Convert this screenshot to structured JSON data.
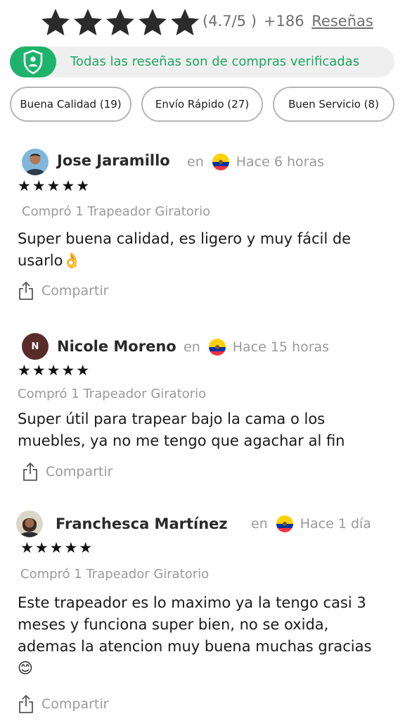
{
  "summary": {
    "star_count": 5,
    "rating": "(4.7/5 )",
    "count": "+186",
    "reviews_link": "Reseñas"
  },
  "verified_banner": {
    "text": "Todas las reseñas son de compras verificadas",
    "icon": "verified-shield-icon",
    "color": "#1db36a"
  },
  "filters": [
    {
      "label": "Buena Calidad (19)"
    },
    {
      "label": "Envío Rápido (27)"
    },
    {
      "label": "Buen Servicio (8)"
    }
  ],
  "reviews": [
    {
      "name": "Jose Jaramillo",
      "avatar": "photo",
      "en": "en",
      "flag": "ecuador-flag-icon",
      "time": "Hace 6 horas",
      "stars": "★★★★★",
      "bought": "Compró 1 Trapeador Giratorio",
      "text": "Super buena calidad, es ligero y muy fácil de usarlo👌",
      "share": "Compartir"
    },
    {
      "name": "Nicole Moreno",
      "avatar": "N",
      "en": "en",
      "flag": "ecuador-flag-icon",
      "time": "Hace 15 horas",
      "stars": "★★★★★",
      "bought": "Compró 1 Trapeador Giratorio",
      "text": "Super útil para trapear bajo la cama o los muebles, ya no me tengo que agachar al fin",
      "share": "Compartir"
    },
    {
      "name": "Franchesca Martínez",
      "avatar": "photo",
      "en": "en",
      "flag": "ecuador-flag-icon",
      "time": "Hace 1 día",
      "stars": "★★★★★",
      "bought": "Compró 1 Trapeador Giratorio",
      "text": "Este trapeador es lo maximo ya la tengo casi 3 meses y funciona super bien, no se oxida, ademas la atencion muy buena muchas gracias 😊",
      "share": "Compartir"
    }
  ]
}
